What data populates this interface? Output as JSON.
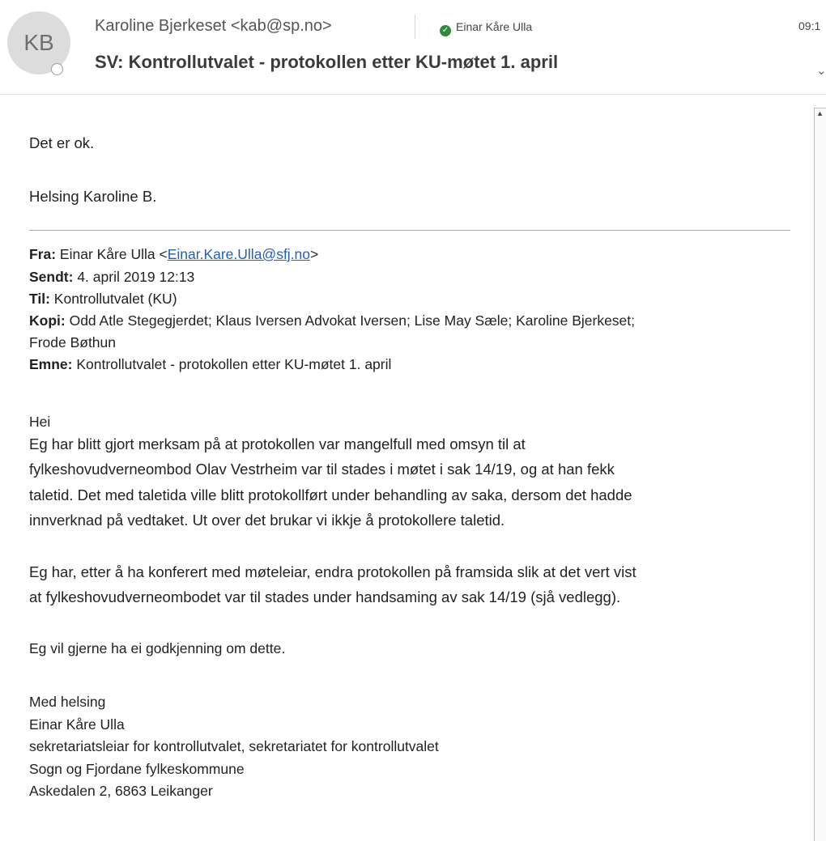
{
  "header": {
    "avatar_initials": "KB",
    "sender": "Karoline Bjerkeset <kab@sp.no>",
    "recipient": "Einar Kåre Ulla",
    "time": "09:1",
    "subject": "SV: Kontrollutvalet -  protokollen etter KU-møtet 1. april"
  },
  "reply": {
    "line1": "Det er ok.",
    "line2": "Helsing Karoline B."
  },
  "quoted": {
    "from_label": "Fra:",
    "from_name": " Einar Kåre Ulla <",
    "from_email": "Einar.Kare.Ulla@sfj.no",
    "from_end": ">",
    "sent_label": "Sendt:",
    "sent_value": " 4. april 2019 12:13",
    "to_label": "Til:",
    "to_value": " Kontrollutvalet (KU)",
    "cc_label": "Kopi:",
    "cc_value_line1": " Odd Atle Stegegjerdet; Klaus Iversen Advokat Iversen; Lise May Sæle; Karoline Bjerkeset;",
    "cc_value_line2": "Frode Bøthun",
    "subject_label": "Emne:",
    "subject_value": " Kontrollutvalet - protokollen etter KU-møtet 1. april"
  },
  "message": {
    "greeting": "Hei",
    "p1": [
      "Eg har blitt gjort merksam på at protokollen var mangelfull med omsyn til at",
      "fylkeshovudverneombod Olav Vestrheim var til stades i møtet i sak 14/19, og at han fekk",
      "taletid. Det med taletida ville blitt protokollført under behandling av saka, dersom det hadde",
      "innverknad på vedtaket. Ut over det brukar vi ikkje å protokollere taletid."
    ],
    "p2": [
      "Eg har, etter å ha konferert med møteleiar,  endra protokollen på framsida slik at det vert vist",
      "at fylkeshovudverneombodet var til stades under handsaming av sak 14/19 (sjå vedlegg)."
    ],
    "p3": "Eg vil gjerne ha ei godkjenning om dette.",
    "signature": [
      "Med helsing",
      "Einar Kåre Ulla",
      "sekretariatsleiar for kontrollutvalet, sekretariatet for kontrollutvalet",
      "Sogn og Fjordane fylkeskommune",
      "Askedalen 2, 6863 Leikanger"
    ]
  }
}
